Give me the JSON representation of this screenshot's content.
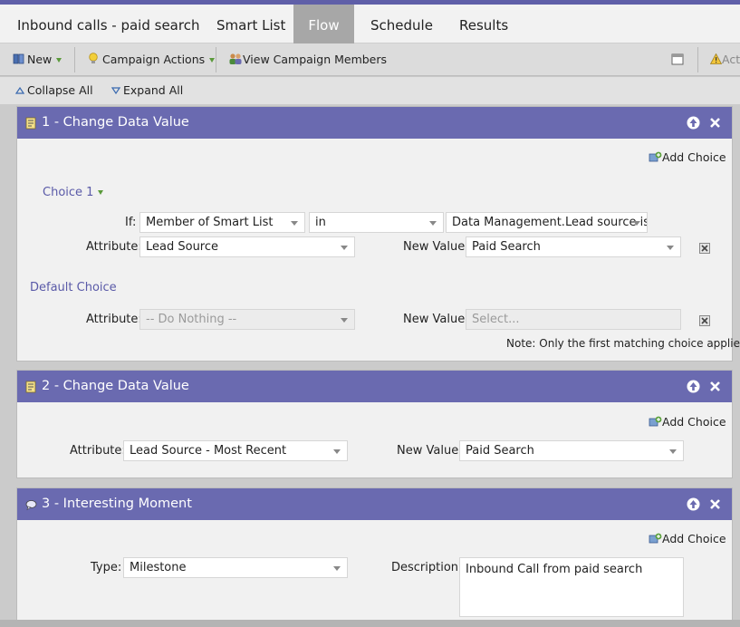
{
  "tabs": [
    {
      "label": "Inbound calls - paid search",
      "active": false
    },
    {
      "label": "Smart List",
      "active": false
    },
    {
      "label": "Flow",
      "active": true
    },
    {
      "label": "Schedule",
      "active": false
    },
    {
      "label": "Results",
      "active": false
    }
  ],
  "toolbar": {
    "new_label": "New",
    "campaign_actions_label": "Campaign Actions",
    "view_members_label": "View Campaign Members",
    "truncated_label": "Act"
  },
  "subbar": {
    "collapse_all": "Collapse All",
    "expand_all": "Expand All"
  },
  "steps": [
    {
      "title": "1 - Change Data Value",
      "add_choice": "Add Choice",
      "choice1": {
        "label": "Choice 1",
        "if_label": "If:",
        "if_field": "Member of Smart List",
        "if_operator": "in",
        "if_value": "Data Management.Lead source is",
        "attribute_label": "Attribute:",
        "attribute_value": "Lead Source",
        "new_value_label": "New Value:",
        "new_value": "Paid Search"
      },
      "default_choice": {
        "label": "Default Choice",
        "attribute_label": "Attribute:",
        "attribute_value": "-- Do Nothing --",
        "new_value_label": "New Value:",
        "new_value_placeholder": "Select..."
      },
      "note": "Note: Only the first matching choice applies"
    },
    {
      "title": "2 - Change Data Value",
      "add_choice": "Add Choice",
      "attribute_label": "Attribute:",
      "attribute_value": "Lead Source - Most Recent",
      "new_value_label": "New Value:",
      "new_value": "Paid Search"
    },
    {
      "title": "3 - Interesting Moment",
      "add_choice": "Add Choice",
      "type_label": "Type:",
      "type_value": "Milestone",
      "description_label": "Description:",
      "description_value": "Inbound Call from paid search"
    }
  ],
  "colors": {
    "step_header": "#6a6ab0",
    "active_tab": "#a7a7a7",
    "link": "#5a5aa8"
  }
}
